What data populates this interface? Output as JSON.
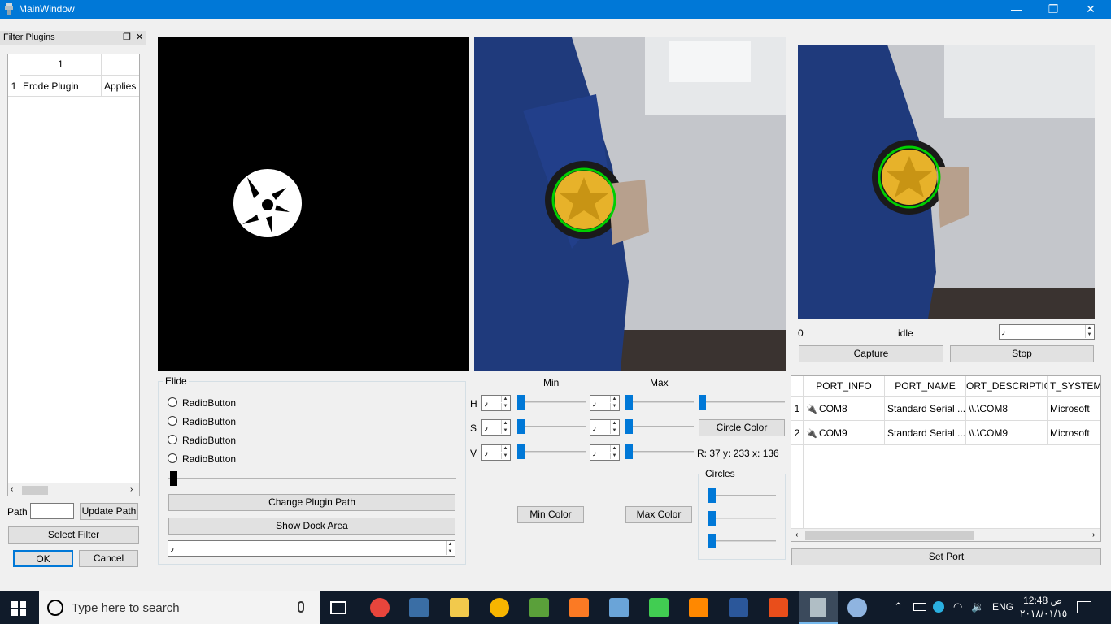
{
  "window": {
    "title": "MainWindow",
    "minimize": "—",
    "restore": "❐",
    "close": "✕"
  },
  "dock": {
    "title": "Filter Plugins",
    "float_glyph": "❐",
    "close_glyph": "✕",
    "table": {
      "col_header": "1",
      "row_header": "1",
      "cells": [
        "Erode Plugin",
        "Applies"
      ]
    },
    "path_label": "Path",
    "path_value": "",
    "update_path": "Update Path",
    "select_filter": "Select Filter",
    "ok": "OK",
    "cancel": "Cancel"
  },
  "camera": {
    "frame_index": "0",
    "status": "idle",
    "spin_value": "٫",
    "capture": "Capture",
    "stop": "Stop"
  },
  "elide": {
    "title": "Elide",
    "radios": [
      "RadioButton",
      "RadioButton",
      "RadioButton",
      "RadioButton"
    ],
    "change_plugin_path": "Change Plugin Path",
    "show_dock_area": "Show Dock Area",
    "combo_value": "٫"
  },
  "hsv": {
    "min_label": "Min",
    "max_label": "Max",
    "rows": [
      {
        "label": "H",
        "min": "٫",
        "max": "٫"
      },
      {
        "label": "S",
        "min": "٫",
        "max": "٫"
      },
      {
        "label": "V",
        "min": "٫",
        "max": "٫"
      }
    ],
    "circle_color": "Circle Color",
    "readout": "R: 37   y: 233  x: 136",
    "circles_title": "Circles",
    "min_color": "Min Color",
    "max_color": "Max Color"
  },
  "ports": {
    "columns": [
      "PORT_INFO",
      "PORT_NAME",
      "ORT_DESCRIPTIOI",
      "T_SYSTEM_L"
    ],
    "rows": [
      {
        "num": "1",
        "info": "COM8",
        "name": "Standard Serial ...",
        "desc": "\\\\.\\COM8",
        "sys": "Microsoft"
      },
      {
        "num": "2",
        "info": "COM9",
        "name": "Standard Serial ...",
        "desc": "\\\\.\\COM9",
        "sys": "Microsoft"
      }
    ],
    "set_port": "Set Port"
  },
  "taskbar": {
    "search_placeholder": "Type here to search",
    "lang": "ENG",
    "time": "12:48 ص",
    "date": "٢٠١٨/٠١/١٥"
  },
  "colors": {
    "accent": "#0078d7",
    "taskbar": "#101b2a",
    "circle": "#00d000"
  }
}
